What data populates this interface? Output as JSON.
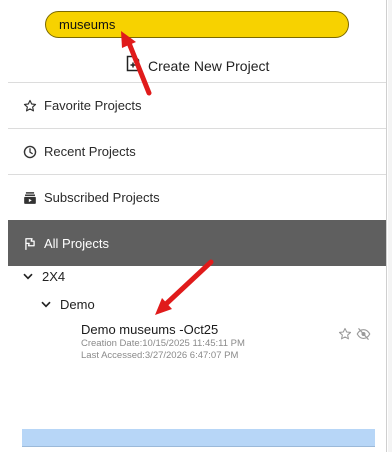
{
  "search": {
    "value": "museums",
    "placeholder": ""
  },
  "create_project": {
    "label": "Create New Project",
    "icon": "new-document-icon"
  },
  "nav": {
    "favorites": {
      "label": "Favorite Projects",
      "icon": "star-outline-icon"
    },
    "recent": {
      "label": "Recent Projects",
      "icon": "clock-icon"
    },
    "subscribed": {
      "label": "Subscribed Projects",
      "icon": "subscription-stack-icon"
    },
    "all": {
      "label": "All Projects",
      "icon": "flag-icon",
      "active": true
    }
  },
  "tree": {
    "root": {
      "label": "2X4",
      "expanded": true
    },
    "folder": {
      "label": "Demo",
      "expanded": true
    },
    "project": {
      "title": "Demo museums -Oct25",
      "creation_date": "Creation Date:10/15/2025 11:45:11 PM",
      "last_accessed": "Last Accessed:3/27/2026 6:47:07 PM",
      "icons": [
        "star-outline-icon",
        "eye-off-icon"
      ]
    }
  },
  "colors": {
    "search_fill": "#f7d200",
    "active_item_bg": "#5f5f5f",
    "annotation_arrow": "#e01b1b",
    "bottom_bar": "#b7d6f7"
  }
}
